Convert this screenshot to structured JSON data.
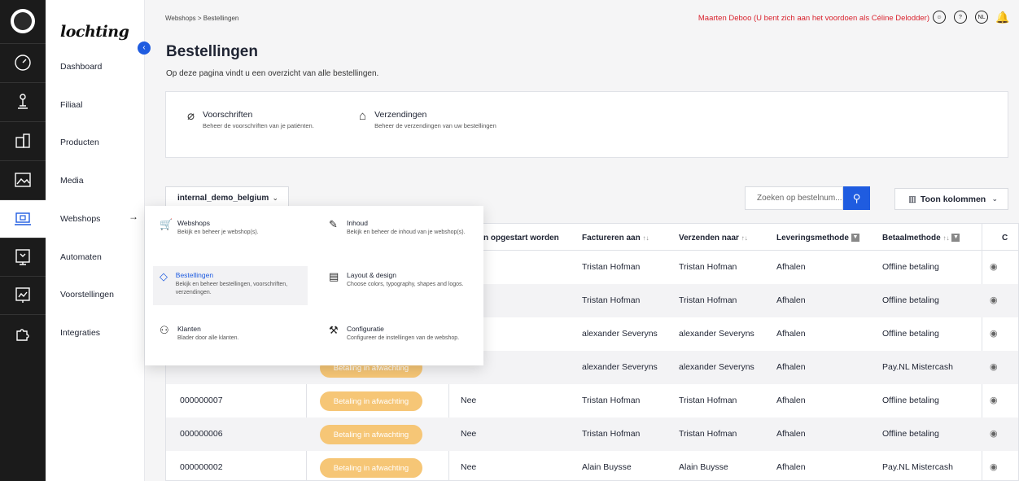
{
  "brand": "lochting",
  "rail": [
    {
      "icon": "dashboard-icon"
    },
    {
      "icon": "branch-icon"
    },
    {
      "icon": "products-icon"
    },
    {
      "icon": "media-icon"
    },
    {
      "icon": "webshop-icon",
      "active": true
    },
    {
      "icon": "automat-icon"
    },
    {
      "icon": "presentation-icon"
    },
    {
      "icon": "puzzle-icon"
    }
  ],
  "nav": [
    "Dashboard",
    "Filiaal",
    "Producten",
    "Media",
    "Webshops",
    "Automaten",
    "Voorstellingen",
    "Integraties"
  ],
  "breadcrumb": "Webshops  >  Bestellingen",
  "impersonation": "Maarten Deboo (U bent zich aan het voordoen als Céline Delodder)",
  "top_icons": [
    "user-icon",
    "help-icon",
    "language-icon",
    "notification-icon"
  ],
  "language_code": "NL",
  "help_glyph": "?",
  "page": {
    "title": "Bestellingen",
    "subtitle": "Op deze pagina vindt u een overzicht van alle bestellingen."
  },
  "quicklinks": [
    {
      "title": "Voorschriften",
      "desc": "Beheer de voorschriften van je patiënten.",
      "icon": "paperclip-icon"
    },
    {
      "title": "Verzendingen",
      "desc": "Beheer de verzendingen van uw bestellingen",
      "icon": "gift-icon"
    }
  ],
  "shop_select": "internal_demo_belgium",
  "search_placeholder": "Zoeken op bestelnum...",
  "columns_button": "Toon kolommen",
  "table": {
    "headers": {
      "c3": "n opgestart worden",
      "c4": "Factureren aan",
      "c5": "Verzenden naar",
      "c6": "Leveringsmethode",
      "c7": "Betaalmethode",
      "c8": "C"
    },
    "status_label": "Betaling in afwachting",
    "rows": [
      {
        "nr": "",
        "c3": "",
        "bill": "Tristan Hofman",
        "ship": "Tristan Hofman",
        "delivery": "Afhalen",
        "pay": "Offline betaling"
      },
      {
        "nr": "",
        "c3": "",
        "bill": "Tristan Hofman",
        "ship": "Tristan Hofman",
        "delivery": "Afhalen",
        "pay": "Offline betaling"
      },
      {
        "nr": "",
        "c3": "",
        "bill": "alexander Severyns",
        "ship": "alexander Severyns",
        "delivery": "Afhalen",
        "pay": "Offline betaling"
      },
      {
        "nr": "",
        "c3": "",
        "bill": "alexander Severyns",
        "ship": "alexander Severyns",
        "delivery": "Afhalen",
        "pay": "Pay.NL Mistercash"
      },
      {
        "nr": "000000007",
        "c3": "Nee",
        "bill": "Tristan Hofman",
        "ship": "Tristan Hofman",
        "delivery": "Afhalen",
        "pay": "Offline betaling"
      },
      {
        "nr": "000000006",
        "c3": "Nee",
        "bill": "Tristan Hofman",
        "ship": "Tristan Hofman",
        "delivery": "Afhalen",
        "pay": "Offline betaling"
      },
      {
        "nr": "000000002",
        "c3": "Nee",
        "bill": "Alain Buysse",
        "ship": "Alain Buysse",
        "delivery": "Afhalen",
        "pay": "Pay.NL Mistercash"
      }
    ]
  },
  "menu": [
    {
      "title": "Webshops",
      "desc": "Bekijk en beheer je webshop(s).",
      "icon": "cart-icon"
    },
    {
      "title": "Inhoud",
      "desc": "Bekijk en beheer de inhoud van je webshop(s).",
      "icon": "pencil-icon"
    },
    {
      "title": "Bestellingen",
      "desc": "Bekijk en beheer bestellingen, voorschriften, verzendingen.",
      "icon": "diamond-icon",
      "active": true
    },
    {
      "title": "Layout & design",
      "desc": "Choose colors, typography, shapes and logos.",
      "icon": "layout-icon"
    },
    {
      "title": "Klanten",
      "desc": "Blader door alle klanten.",
      "icon": "customers-icon"
    },
    {
      "title": "Configuratie",
      "desc": "Configureer de instellingen van de webshop.",
      "icon": "tools-icon"
    }
  ],
  "colors": {
    "accent": "#1f5ce0",
    "status": "#f6c676",
    "impersonation": "#d9232e"
  }
}
